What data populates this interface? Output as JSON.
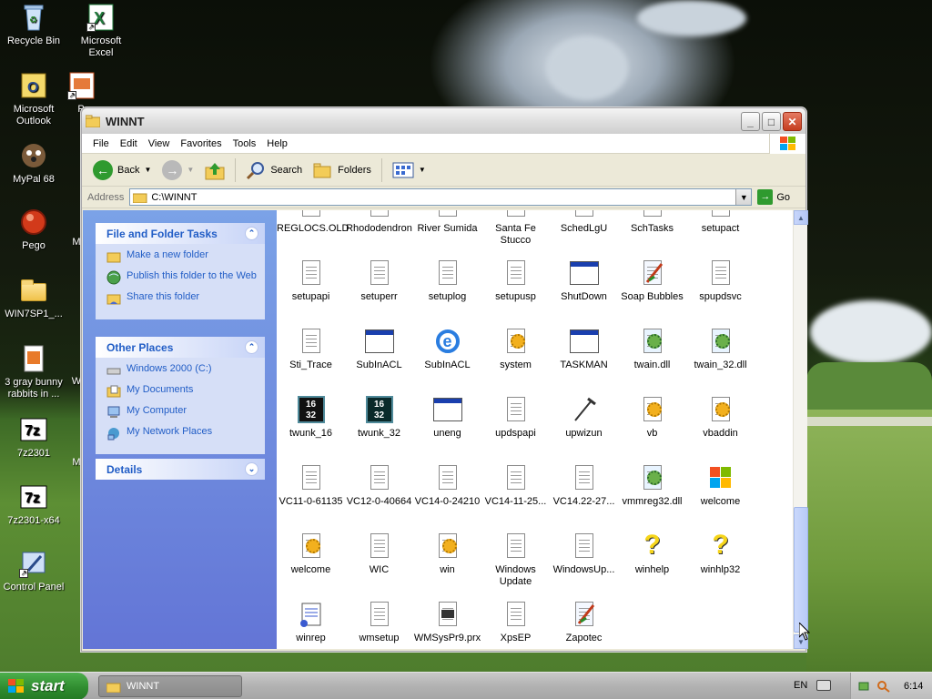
{
  "desktop": {
    "icons": [
      {
        "label": "Recycle Bin",
        "icon": "recycle-bin-icon"
      },
      {
        "label": "Microsoft Excel",
        "icon": "excel-icon"
      },
      {
        "label": "Microsoft Outlook",
        "icon": "outlook-icon"
      },
      {
        "label": "MyPal 68",
        "icon": "mypal-icon"
      },
      {
        "label": "Pego",
        "icon": "pego-icon"
      },
      {
        "label": "WIN7SP1_...",
        "icon": "folder-icon"
      },
      {
        "label": "3 gray bunny rabbits in ...",
        "icon": "image-file-icon"
      },
      {
        "label": "7z2301",
        "icon": "7zip-icon"
      },
      {
        "label": "7z2301-x64",
        "icon": "7zip-icon"
      },
      {
        "label": "Control Panel",
        "icon": "control-panel-icon"
      }
    ],
    "partial_labels": {
      "pp": "P",
      "m1": "M",
      "w": "W",
      "m2": "M"
    }
  },
  "window": {
    "title": "WINNT",
    "menu": [
      "File",
      "Edit",
      "View",
      "Favorites",
      "Tools",
      "Help"
    ],
    "toolbar": {
      "back": "Back",
      "search": "Search",
      "folders": "Folders"
    },
    "address": {
      "label": "Address",
      "value": "C:\\WINNT",
      "go": "Go"
    },
    "tasks": {
      "title": "File and Folder Tasks",
      "items": [
        "Make a new folder",
        "Publish this folder to the Web",
        "Share this folder"
      ]
    },
    "other_places": {
      "title": "Other Places",
      "items": [
        "Windows 2000 (C:)",
        "My Documents",
        "My Computer",
        "My Network Places"
      ]
    },
    "details": {
      "title": "Details"
    },
    "files": [
      {
        "name": "REGLOCS.OLD",
        "type": "doc"
      },
      {
        "name": "Rhododendron",
        "type": "doc"
      },
      {
        "name": "River Sumida",
        "type": "doc"
      },
      {
        "name": "Santa Fe Stucco",
        "type": "doc"
      },
      {
        "name": "SchedLgU",
        "type": "doc"
      },
      {
        "name": "SchTasks",
        "type": "doc"
      },
      {
        "name": "setupact",
        "type": "doc"
      },
      {
        "name": "setupapi",
        "type": "doc"
      },
      {
        "name": "setuperr",
        "type": "doc"
      },
      {
        "name": "setuplog",
        "type": "doc"
      },
      {
        "name": "setupusp",
        "type": "doc"
      },
      {
        "name": "ShutDown",
        "type": "app"
      },
      {
        "name": "Soap Bubbles",
        "type": "paint"
      },
      {
        "name": "spupdsvc",
        "type": "doc"
      },
      {
        "name": "Sti_Trace",
        "type": "doc"
      },
      {
        "name": "SubInACL",
        "type": "app"
      },
      {
        "name": "SubInACL",
        "type": "ie"
      },
      {
        "name": "system",
        "type": "cfg"
      },
      {
        "name": "TASKMAN",
        "type": "app"
      },
      {
        "name": "twain.dll",
        "type": "dll"
      },
      {
        "name": "twain_32.dll",
        "type": "dll"
      },
      {
        "name": "twunk_16",
        "type": "w16"
      },
      {
        "name": "twunk_32",
        "type": "w32"
      },
      {
        "name": "uneng",
        "type": "app"
      },
      {
        "name": "updspapi",
        "type": "doc"
      },
      {
        "name": "upwizun",
        "type": "hammer"
      },
      {
        "name": "vb",
        "type": "cfg"
      },
      {
        "name": "vbaddin",
        "type": "cfg"
      },
      {
        "name": "VC11-0-61135",
        "type": "doc"
      },
      {
        "name": "VC12-0-40664",
        "type": "doc"
      },
      {
        "name": "VC14-0-24210",
        "type": "doc"
      },
      {
        "name": "VC14-11-25...",
        "type": "doc"
      },
      {
        "name": "VC14.22-27...",
        "type": "doc"
      },
      {
        "name": "vmmreg32.dll",
        "type": "dll"
      },
      {
        "name": "welcome",
        "type": "flag"
      },
      {
        "name": "welcome",
        "type": "cfg"
      },
      {
        "name": "WIC",
        "type": "doc"
      },
      {
        "name": "win",
        "type": "cfg"
      },
      {
        "name": "Windows Update",
        "type": "doc"
      },
      {
        "name": "WindowsUp...",
        "type": "doc"
      },
      {
        "name": "winhelp",
        "type": "help"
      },
      {
        "name": "winhlp32",
        "type": "help"
      },
      {
        "name": "winrep",
        "type": "scroll"
      },
      {
        "name": "wmsetup",
        "type": "doc"
      },
      {
        "name": "WMSysPr9.prx",
        "type": "prx"
      },
      {
        "name": "XpsEP",
        "type": "doc"
      },
      {
        "name": "Zapotec",
        "type": "paint"
      }
    ]
  },
  "taskbar": {
    "start": "start",
    "task": "WINNT",
    "lang": "EN",
    "clock": "6:14"
  }
}
